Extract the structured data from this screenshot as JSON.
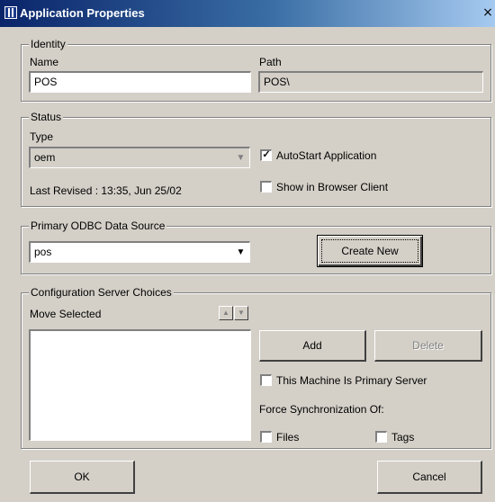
{
  "window": {
    "title": "Application Properties",
    "close_glyph": "×",
    "app_icon": "app-icon"
  },
  "identity": {
    "group_label": "Identity",
    "name_label": "Name",
    "name_value": "POS",
    "path_label": "Path",
    "path_value": "POS\\"
  },
  "status": {
    "group_label": "Status",
    "type_label": "Type",
    "type_value": "oem",
    "last_revised": "Last Revised : 13:35, Jun 25/02",
    "autostart_label": "AutoStart Application",
    "autostart_checked": true,
    "browser_label": "Show in Browser Client",
    "browser_checked": false
  },
  "odbc": {
    "group_label": "Primary ODBC Data Source",
    "source_value": "pos",
    "create_new_label": "Create New"
  },
  "config": {
    "group_label": "Configuration Server Choices",
    "move_selected_label": "Move Selected",
    "add_label": "Add",
    "delete_label": "Delete",
    "primary_label": "This Machine Is Primary Server",
    "primary_checked": false,
    "force_sync_label": "Force Synchronization Of:",
    "files_label": "Files",
    "files_checked": false,
    "tags_label": "Tags",
    "tags_checked": false,
    "servers": []
  },
  "footer": {
    "ok_label": "OK",
    "cancel_label": "Cancel"
  },
  "glyphs": {
    "check": "✓",
    "dropdown": "▼",
    "up": "▲",
    "down": "▼"
  }
}
